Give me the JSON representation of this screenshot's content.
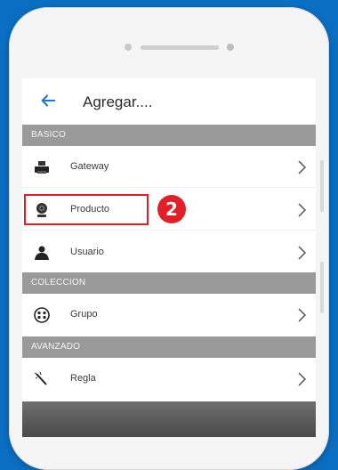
{
  "appbar": {
    "title": "Agregar...."
  },
  "sections": {
    "basico": "BASICO",
    "coleccion": "COLECCION",
    "avanzado": "AVANZADO"
  },
  "items": {
    "gateway": {
      "label": "Gateway",
      "icon": "printer-icon"
    },
    "producto": {
      "label": "Producto",
      "icon": "webcam-icon"
    },
    "usuario": {
      "label": "Usuario",
      "icon": "user-icon"
    },
    "grupo": {
      "label": "Grupo",
      "icon": "group-icon"
    },
    "regla": {
      "label": "Regla",
      "icon": "magic-wand-icon"
    }
  },
  "annotation": {
    "step_number": "2",
    "color": "#e41e26"
  },
  "colors": {
    "background": "#0a6fc2",
    "section_header": "#9a9a9a"
  }
}
